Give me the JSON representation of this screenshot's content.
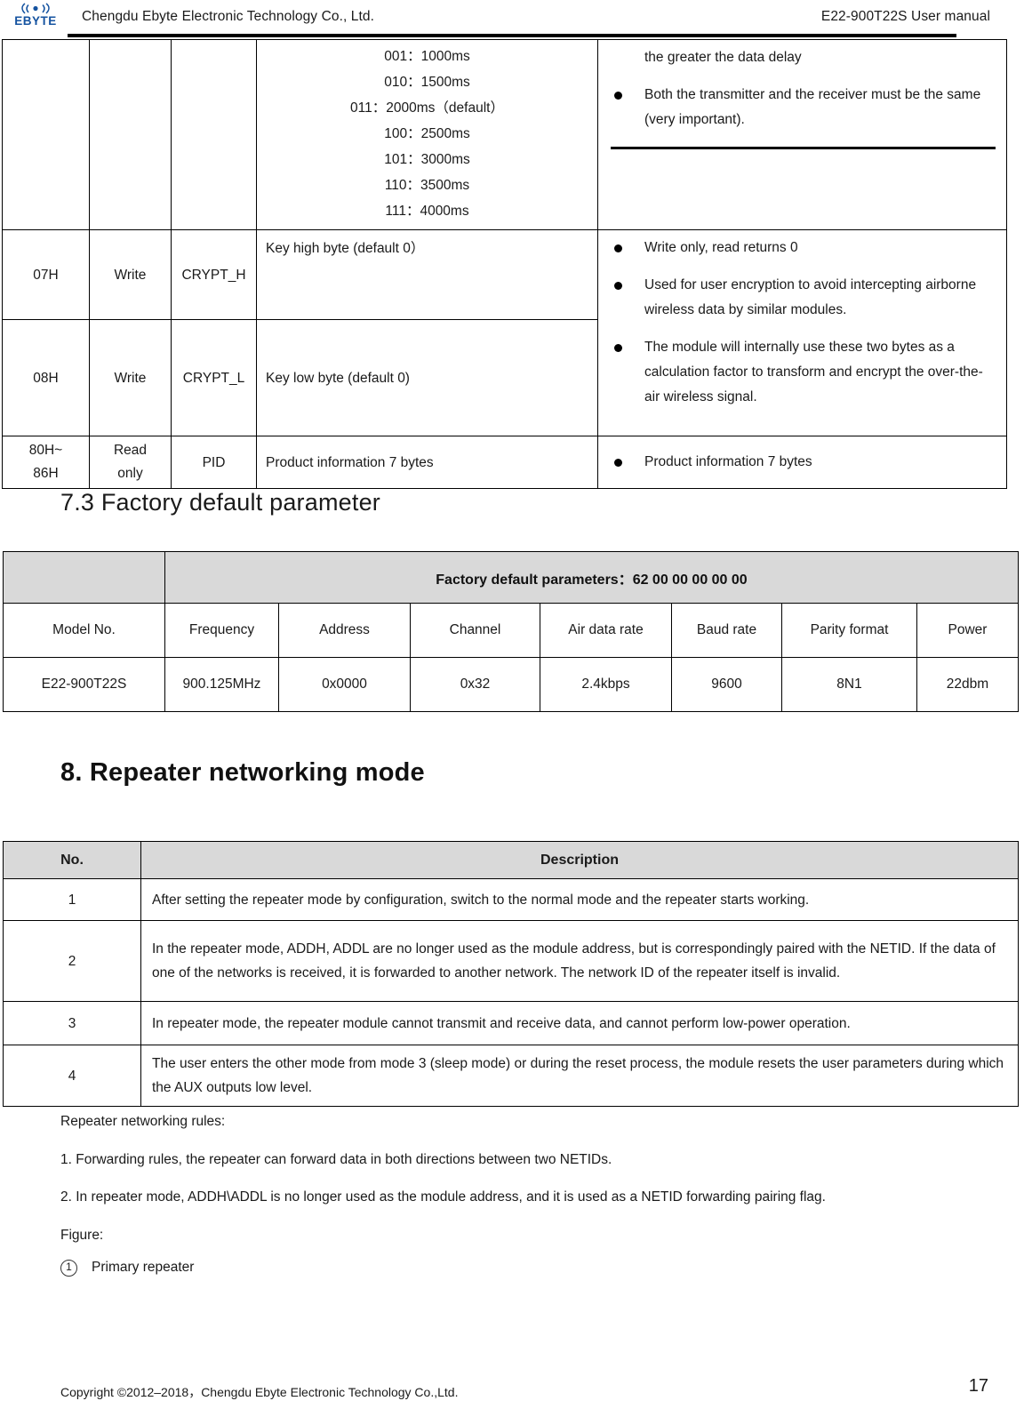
{
  "header": {
    "logo_text": "EBYTE",
    "logo_icon": "antenna-signal-icon",
    "company": "Chengdu Ebyte Electronic Technology Co., Ltd.",
    "manual_title": "E22-900T22S User manual"
  },
  "register_table": {
    "continued_row": {
      "options": [
        "001：1000ms",
        "010：1500ms",
        "011：2000ms（default）",
        "100：2500ms",
        "101：3000ms",
        "110：3500ms",
        "111：4000ms"
      ],
      "notes_first_line": "the greater the data delay",
      "notes": [
        "Both the transmitter and the receiver must be the same (very important)."
      ]
    },
    "rows": [
      {
        "address": "07H",
        "rw": "Write",
        "name": "CRYPT_H",
        "description": "Key high byte (default 0）"
      },
      {
        "address": "08H",
        "rw": "Write",
        "name": "CRYPT_L",
        "description": "Key low byte (default 0)"
      },
      {
        "address": "80H~86H",
        "address_line1": "80H~",
        "address_line2": "86H",
        "rw": "Read only",
        "rw_line1": "Read",
        "rw_line2": "only",
        "name": "PID",
        "description": "Product information 7 bytes",
        "note": "Product information 7 bytes"
      }
    ],
    "crypt_notes": [
      "Write only, read returns 0",
      "Used for user encryption to avoid intercepting airborne wireless data by similar modules.",
      "The module will internally use these two bytes as a calculation factor to transform and encrypt the over-the-air wireless signal."
    ]
  },
  "section_73": {
    "heading": "7.3 Factory default parameter"
  },
  "factory_table": {
    "banner": "Factory default parameters：62 00 00 00 00 00",
    "columns": [
      "Model No.",
      "Frequency",
      "Address",
      "Channel",
      "Air data rate",
      "Baud rate",
      "Parity format",
      "Power"
    ],
    "values": [
      "E22-900T22S",
      "900.125MHz",
      "0x0000",
      "0x32",
      "2.4kbps",
      "9600",
      "8N1",
      "22dbm"
    ]
  },
  "section_8": {
    "heading": "8. Repeater networking mode"
  },
  "repeater_table": {
    "columns": [
      "No.",
      "Description"
    ],
    "rows": [
      {
        "no": "1",
        "description": "After setting the repeater mode by configuration, switch to the normal mode and the repeater starts working."
      },
      {
        "no": "2",
        "description": "In the repeater mode, ADDH, ADDL are no longer used as the module address, but is correspondingly paired with the NETID. If the data of one of the networks is received, it is forwarded to another network. The network ID of the repeater itself is invalid."
      },
      {
        "no": "3",
        "description": "In repeater mode, the repeater module cannot transmit and receive data, and cannot perform low-power operation."
      },
      {
        "no": "4",
        "description": "The user enters the other mode from mode 3 (sleep mode) or during the reset process, the module resets the user parameters during which the AUX outputs low level."
      }
    ]
  },
  "body": {
    "rules_title": "Repeater networking rules:",
    "rule_1": "1. Forwarding rules, the repeater can forward data in both directions between two NETIDs.",
    "rule_2": "2.  In repeater mode, ADDH\\ADDL is no longer used as the module address, and it is used as a NETID forwarding pairing flag.",
    "figure_label": "Figure:",
    "figure_item_num": "1",
    "figure_item_text": "Primary repeater"
  },
  "footer": {
    "copyright": "Copyright ©2012–2018，Chengdu Ebyte Electronic Technology Co.,Ltd.",
    "page_number": "17"
  }
}
